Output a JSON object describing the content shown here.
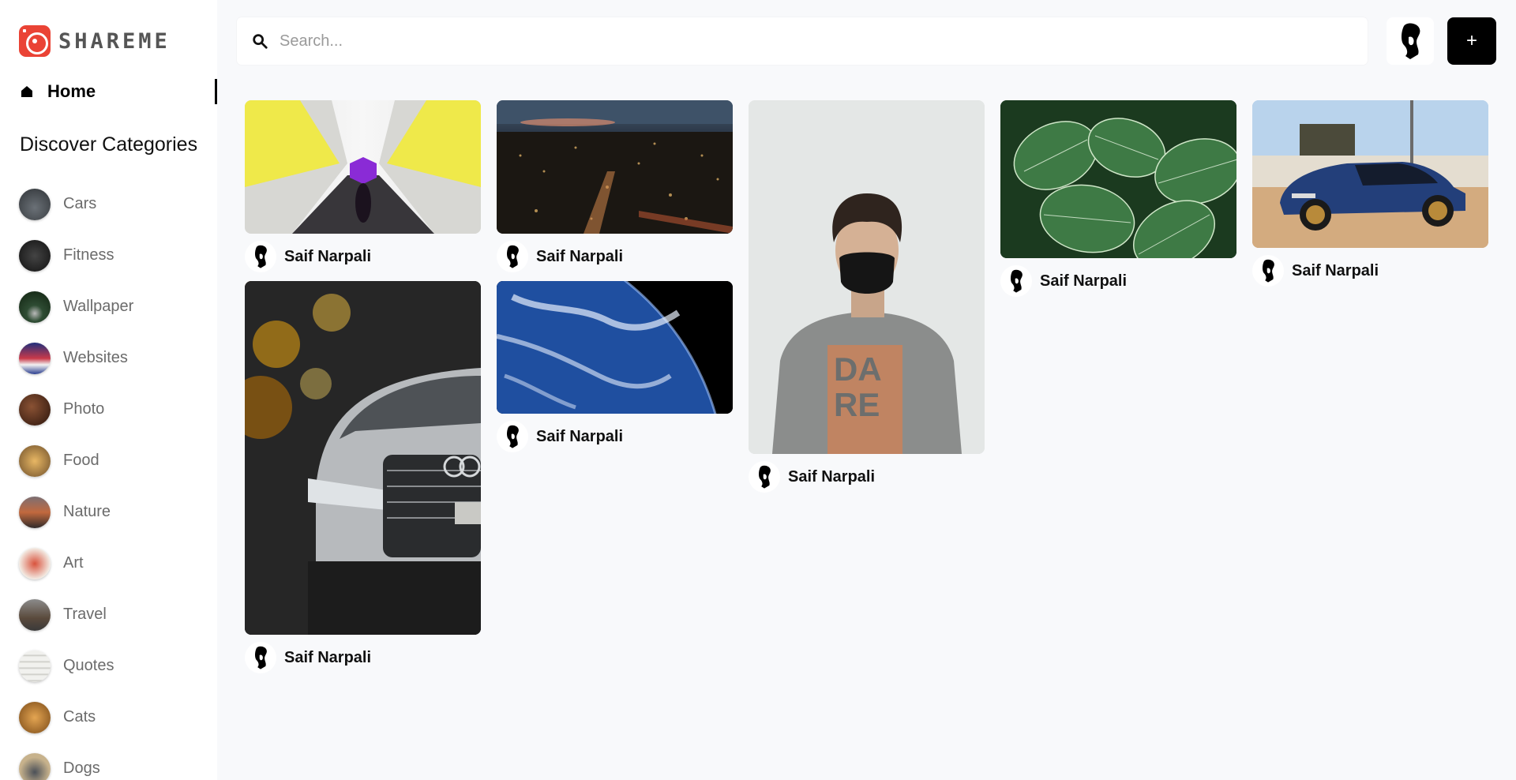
{
  "app": {
    "name": "SHAREME"
  },
  "nav": {
    "home_label": "Home"
  },
  "sidebar": {
    "heading": "Discover Categories",
    "categories": [
      {
        "label": "Cars",
        "color": "#4a4f55"
      },
      {
        "label": "Fitness",
        "color": "#1f1f1f"
      },
      {
        "label": "Wallpaper",
        "color": "#1d3422"
      },
      {
        "label": "Websites",
        "color": "#2a3d8f"
      },
      {
        "label": "Photo",
        "color": "#5a2e1c"
      },
      {
        "label": "Food",
        "color": "#b7863e"
      },
      {
        "label": "Nature",
        "color": "#4b3b33"
      },
      {
        "label": "Art",
        "color": "#c44b35"
      },
      {
        "label": "Travel",
        "color": "#6b6b6b"
      },
      {
        "label": "Quotes",
        "color": "#e9e9e4"
      },
      {
        "label": "Cats",
        "color": "#d18b2f"
      },
      {
        "label": "Dogs",
        "color": "#9f8c6d"
      }
    ]
  },
  "search": {
    "placeholder": "Search..."
  },
  "header": {
    "add_label": "+"
  },
  "pins": [
    {
      "author": "Saif Narpali",
      "image": "corridor"
    },
    {
      "author": "Saif Narpali",
      "image": "city-night"
    },
    {
      "author": "Saif Narpali",
      "image": "portrait-mask"
    },
    {
      "author": "Saif Narpali",
      "image": "leaves"
    },
    {
      "author": "Saif Narpali",
      "image": "bmw-car"
    },
    {
      "author": "Saif Narpali",
      "image": "audi-car"
    },
    {
      "author": "Saif Narpali",
      "image": "earth"
    }
  ]
}
